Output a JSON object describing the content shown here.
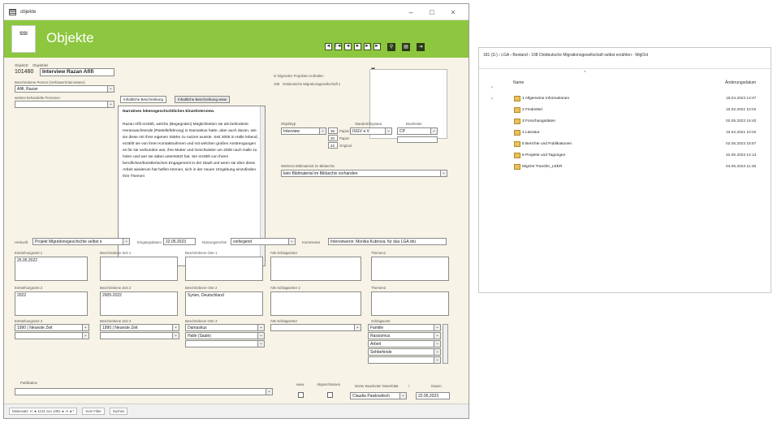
{
  "window": {
    "title": "objekte",
    "min": "–",
    "max": "□",
    "close": "×"
  },
  "header": {
    "title": "Objekte",
    "logo": "SSI"
  },
  "nav": {
    "buttons": [
      "◄",
      "I◄",
      "◄",
      "►",
      "►I",
      "►*"
    ]
  },
  "form": {
    "objektid_label": "ObjektID",
    "objektid": "101480",
    "objekttitel_label": "Objekttitel",
    "objekttitel": "Interview Razan Afifi",
    "person_label": "Beschriebene Person (Verfasser/Interviewter)",
    "person": "Afifi, Razan",
    "weitere_label": "weitere behandelte Personen",
    "projekte_label": "in folgenden Projekten enthalten",
    "projekt_id": "108",
    "projekt_name": "Ostdeutsche Migrationsgesellschaft s",
    "tab1": "Inhaltliche Beschreibung",
    "tab2": "Inhaltliche Beschreibung www",
    "desc_heading": "Narratives lebensgeschichtliches Einzelinterview.",
    "desc_body": "Razan Afifi erzählt, welche (Begegnden) Möglichkeiten sie als behinderte Heranwachsende (Rüstelleführung) in Damaskus hatte, aber auch davon, wie sie diese mit ihrer eigenen Stärke zu nutzen wusste. Seit 2005 in Halle lebend, erzählt sie von ihren Kontaktnahmen und mit welchen großen Anstrengungen es für sie verbunden war, ihre Mutter und Geschwister um 2005 nach Halle zu holen und wer sie dabei unterstützt hat. Sie erzählt von ihrem beruflichen/künstlerischen Engagement in der Stadt und wenn sie über diese Arbeit wiederum hat helfen können, sich in der neuen Umgebung einzufinden. Ihre Themen",
    "objekttyp_label": "Objekttyp",
    "objekttyp": "Interview",
    "standort_label": "Standort/Signatur",
    "standort": "ISGV e.V.",
    "bearbeiter_label": "Bearbeiter",
    "bearbeiter": "CP",
    "anzahl": [
      "36",
      "20",
      "22"
    ],
    "formats": [
      "Papier",
      "Papier",
      "Original"
    ],
    "bildmaterial_label": "Weiteres Bildmaterial im Bildarchiv",
    "bildmaterial": "kein Bildmaterial im Bildarchiv vorhanden",
    "herkunft_label": "Herkunft",
    "herkunft": "Projekt Migrationsgeschichte selbst e",
    "eingang_label": "Eingangsdatum",
    "eingang": "22.05.2023",
    "nutzung_label": "Nutzungsrechte",
    "nutzung": "vorliegend",
    "kommentar_label": "Kommentar",
    "kommentar": "Interviewerin: Monika Kubrova; für das LGA drü",
    "ez1_label": "Entstehungszeit 1",
    "ez1": "25.05.2022",
    "bz1_label": "Beschriebene Zeit 1",
    "bo1_label": "Beschriebene Orte 1",
    "sw1_label": "IVB Schlagwörter",
    "th1_label": "Themen1",
    "ez2_label": "Entstehungszeit 2",
    "ez2": "2022",
    "bz2_label": "Beschriebene Zeit 2",
    "bz2": "2005-2022",
    "bo2_label": "Beschriebene Orte 2",
    "bo2": "Syrien, Deutschland",
    "sw2_label": "IVB Schlagwörter 2",
    "th2_label": "Themen2",
    "ez3_label": "Entstehungszeit 3",
    "ez3": "1990 | Neueste Zeit",
    "bz3_label": "Beschriebene Zeit 3",
    "bz3": "1990 | Neueste Zeit",
    "bo3_label": "Beschriebene Orte 3",
    "bo3a": "Damaskus",
    "bo3b": "Halle (Saale)",
    "sw3_label": "IVB Schlagwörter",
    "schlag_label": "Schlagworte",
    "schlag": [
      "Familie",
      "Rassismus",
      "Arbeit",
      "Sehbehinde"
    ],
    "publikation_label": "Publikation",
    "www_label": "www",
    "abgeschlossen_label": "Abgeschlossen",
    "letzter_label": "letzter Bearbeiter Datenblatt",
    "slash": "/",
    "datum_label": "Datum",
    "letzter": "Claudia Pawlowitsch",
    "datum": "22.05.2023"
  },
  "status": {
    "record": "Datensatz: H  ◄ 1131 von 1391  ► H ►*",
    "filter": "Kein Filter",
    "search": "Suchen"
  },
  "explorer": {
    "path": "181 (S:)  ›  LGA  ›  Bestand  ›  108 Ostdeutsche Migrationsgesellschaft selbst erzählen - MigOst",
    "col_name": "Name",
    "col_date": "Änderungsdatum",
    "rows": [
      {
        "name": "1 Allgemeine Informationen",
        "date": "18.04.2023 13:47"
      },
      {
        "name": "2 Findmittel",
        "date": "16.02.2021 10:02"
      },
      {
        "name": "3 Forschungsdaten",
        "date": "02.05.2023 15:40"
      },
      {
        "name": "4 Literatur",
        "date": "16.02.2021 10:02"
      },
      {
        "name": "5 Berichte und Publikationen",
        "date": "02.05.2023 15:57"
      },
      {
        "name": "6 Projekte und Tagungen",
        "date": "22.05.2023 14:13"
      },
      {
        "name": "MigOst Transfer_LEER",
        "date": "04.05.2023 11:48"
      }
    ]
  }
}
